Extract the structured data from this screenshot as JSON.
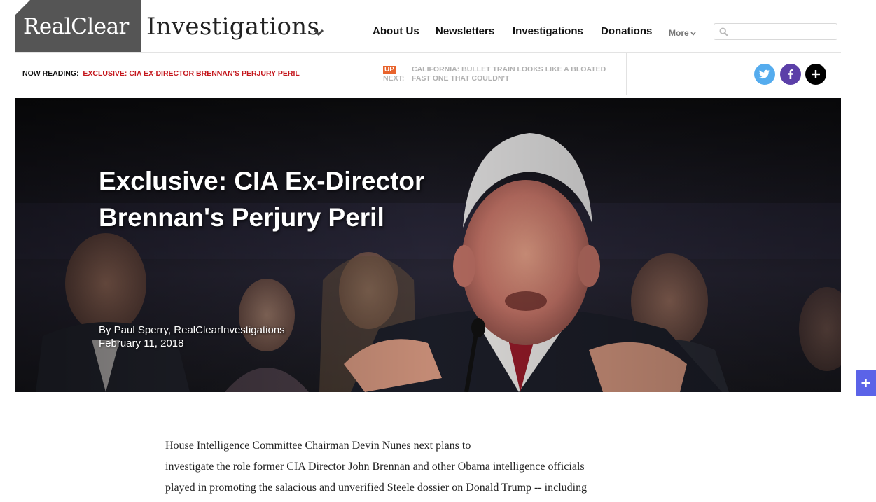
{
  "header": {
    "logo_primary": "RealClear",
    "logo_section": "Investigations",
    "nav": [
      "About Us",
      "Newsletters",
      "Investigations",
      "Donations"
    ],
    "more_label": "More",
    "search": {
      "placeholder": "",
      "value": ""
    }
  },
  "reading_bar": {
    "now_reading_label": "NOW READING:",
    "now_reading_title": "EXCLUSIVE: CIA EX-DIRECTOR BRENNAN'S PERJURY PERIL",
    "up_label": "UP",
    "next_label": "NEXT:",
    "up_next_title": "CALIFORNIA: BULLET TRAIN LOOKS LIKE A BLOATED FAST ONE THAT COULDN'T"
  },
  "social": [
    {
      "icon": "twitter-icon",
      "color": "#55acee"
    },
    {
      "icon": "facebook-icon",
      "color": "#5b3fa8"
    },
    {
      "icon": "plus-icon",
      "color": "#000000"
    }
  ],
  "hero": {
    "title": "Exclusive: CIA Ex-Director Brennan's Perjury Peril",
    "byline": "By Paul Sperry, RealClearInvestigations",
    "date": "February 11, 2018"
  },
  "article": {
    "lines": [
      "House Intelligence Committee Chairman Devin Nunes next plans to",
      "investigate the role former CIA Director John Brennan and other Obama intelligence officials",
      "played in promoting the salacious and unverified Steele dossier on Donald Trump -- including"
    ]
  },
  "colors": {
    "accent_red": "#c4161c",
    "up_tag": "#e8632c",
    "float_button": "#5b63e8"
  }
}
